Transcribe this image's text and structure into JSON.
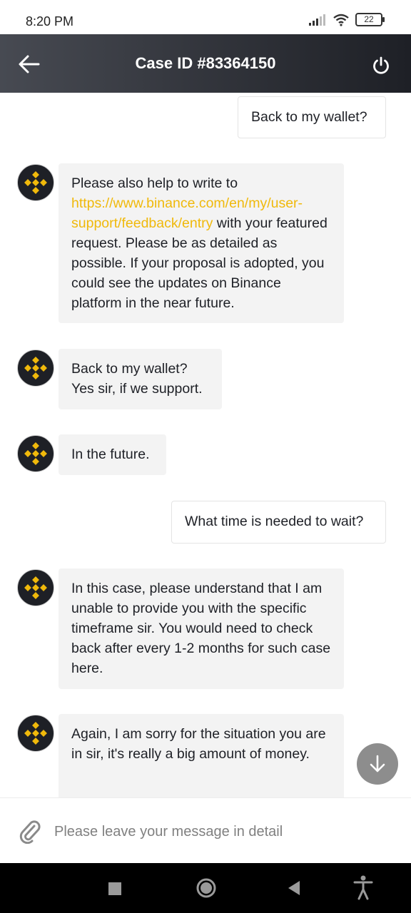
{
  "status_bar": {
    "time": "8:20 PM",
    "battery": "22"
  },
  "header": {
    "title": "Case ID #83364150"
  },
  "messages": [
    {
      "sender": "user",
      "text": "Back to my wallet?"
    },
    {
      "sender": "agent",
      "text_before_link": "Please also help to write to ",
      "link": "https://www.binance.com/en/my/user-support/feedback/entry",
      "text_after_link": " with your featured request. Please be as detailed as possible. If your proposal is adopted, you could see the updates on Binance platform in the near future."
    },
    {
      "sender": "agent",
      "line1": "Back to my wallet?",
      "line2": "Yes sir, if we support."
    },
    {
      "sender": "agent",
      "text": "In the future."
    },
    {
      "sender": "user",
      "text": "What time is needed to wait?"
    },
    {
      "sender": "agent",
      "text": "In this case, please understand that I am unable to provide you with the specific timeframe sir. You would need to check back after every 1-2 months for such case here."
    },
    {
      "sender": "agent",
      "text": "Again, I am sorry for the situation you are in sir, it's really a big amount of money."
    }
  ],
  "composer": {
    "placeholder": "Please leave your message in detail"
  },
  "icons": {
    "back": "arrow-left-icon",
    "power": "power-icon",
    "avatar": "binance-logo-icon",
    "scroll_down": "arrow-down-icon",
    "attach": "paperclip-icon"
  },
  "colors": {
    "accent": "#f0b90b",
    "header_dark": "#1e2026",
    "bubble_agent": "#f3f3f3"
  }
}
